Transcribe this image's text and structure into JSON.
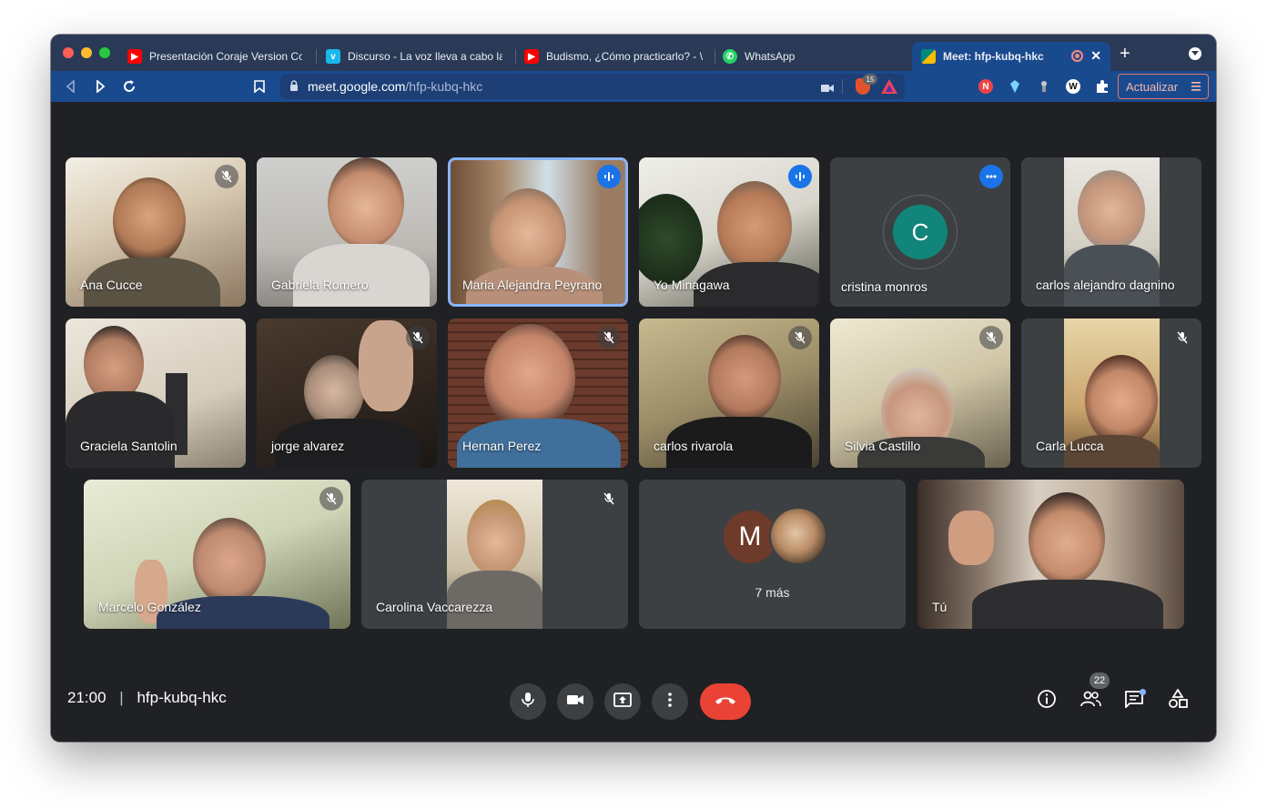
{
  "browser": {
    "tabs": [
      {
        "label": "Presentación Coraje Version Co",
        "icon": "youtube-icon",
        "color": "#ff0000"
      },
      {
        "label": "Discurso - La voz lleva a cabo la",
        "icon": "vimeo-icon",
        "color": "#1ab7ea"
      },
      {
        "label": "Budismo, ¿Cómo practicarlo? - \\",
        "icon": "youtube-icon",
        "color": "#ff0000"
      },
      {
        "label": "WhatsApp",
        "icon": "whatsapp-icon",
        "color": "#25d366"
      },
      {
        "label": "Meet: hfp-kubq-hkc",
        "icon": "google-meet-icon",
        "color": "#00897b"
      }
    ],
    "new_tab_label": "+",
    "url_host": "meet.google.com",
    "url_path": "/hfp-kubq-hkc",
    "brave_badge": "15",
    "update_button": "Actualizar",
    "accent": "#1a4a8e"
  },
  "meeting": {
    "participants": [
      {
        "name": "Ana Cucce",
        "state": "muted"
      },
      {
        "name": "Gabriela Romero",
        "state": "none"
      },
      {
        "name": "Maria Alejandra Peyrano",
        "state": "speaking"
      },
      {
        "name": "Yo Minagawa",
        "state": "speaking"
      },
      {
        "name": "cristina monros",
        "state": "speaking",
        "avatar_letter": "C"
      },
      {
        "name": "carlos alejandro dagnino",
        "state": "none"
      },
      {
        "name": "Graciela Santolin",
        "state": "none"
      },
      {
        "name": "jorge alvarez",
        "state": "muted"
      },
      {
        "name": "Hernan Perez",
        "state": "muted"
      },
      {
        "name": "carlos rivarola",
        "state": "muted"
      },
      {
        "name": "Silvia Castillo",
        "state": "muted"
      },
      {
        "name": "Carla Lucca",
        "state": "muted"
      },
      {
        "name": "Marcelo González",
        "state": "muted"
      },
      {
        "name": "Carolina Vaccarezza",
        "state": "muted"
      },
      {
        "name": "Tú",
        "state": "none"
      }
    ],
    "more_tile": {
      "avatar_letter": "M",
      "label": "7 más"
    },
    "time": "21:00",
    "separator": "|",
    "meeting_code": "hfp-kubq-hkc",
    "people_count": "22",
    "hangup_color": "#ea4335",
    "speaking_color": "#1a73e8"
  }
}
